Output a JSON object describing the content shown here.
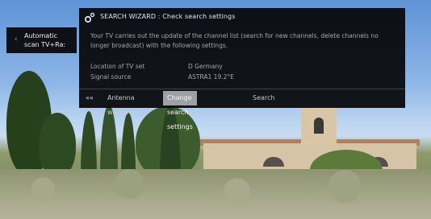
{
  "side_panel": {
    "label": "Automatic\nscan TV+Ra:",
    "arrow_icon": "chevron-left-icon"
  },
  "dialog": {
    "icon": "gear-icon",
    "title": "SEARCH WIZARD : Check search settings",
    "body_text": "Your TV carries out the update of the channel list (search for new channels, delete channels no longer broadcast) with the following settings.",
    "info": [
      {
        "label": "Location of TV set",
        "value": "D Germany"
      },
      {
        "label": "Signal source",
        "value": "ASTRA1 19.2°E"
      }
    ],
    "nav": {
      "back_icon": "double-chevron-left-icon",
      "items": [
        {
          "label": "Antenna wizard"
        },
        {
          "label": "Change search settings"
        },
        {
          "label": "Search"
        }
      ],
      "active_index": 1
    }
  }
}
